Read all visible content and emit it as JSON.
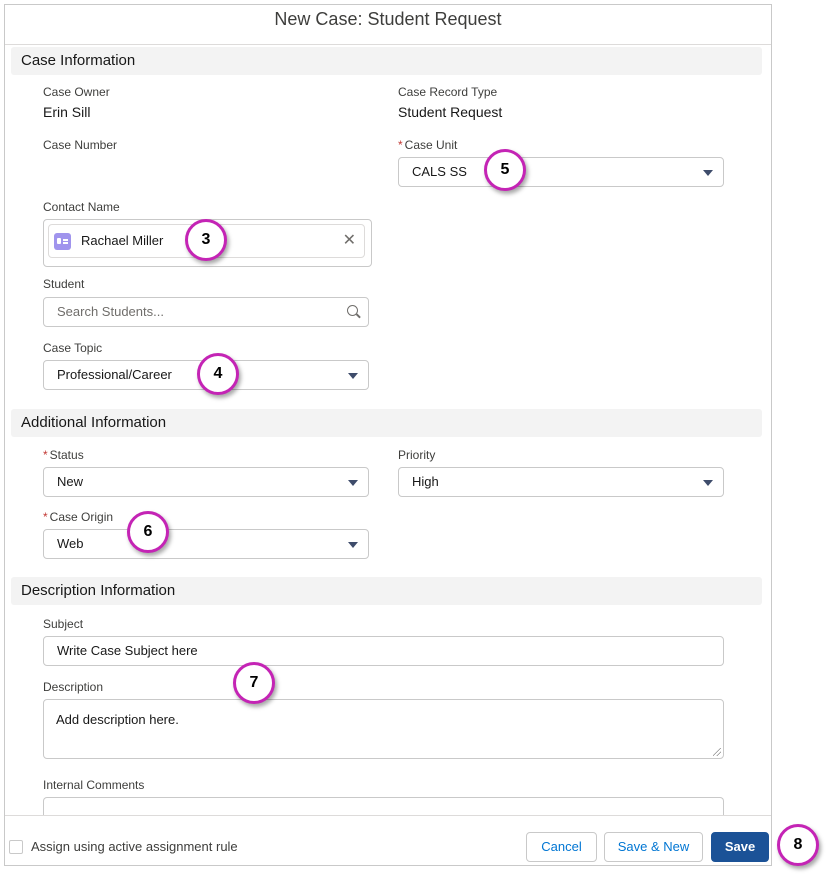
{
  "modal": {
    "title": "New Case: Student Request"
  },
  "sections": {
    "case_information": "Case Information",
    "additional_information": "Additional Information",
    "description_information": "Description Information"
  },
  "fields": {
    "case_owner": {
      "label": "Case Owner",
      "value": "Erin Sill"
    },
    "case_record_type": {
      "label": "Case Record Type",
      "value": "Student Request"
    },
    "case_number": {
      "label": "Case Number",
      "value": ""
    },
    "case_unit": {
      "label": "Case Unit",
      "value": "CALS SS",
      "required": true
    },
    "contact_name": {
      "label": "Contact Name",
      "value": "Rachael Miller"
    },
    "student": {
      "label": "Student",
      "placeholder": "Search Students..."
    },
    "case_topic": {
      "label": "Case Topic",
      "value": "Professional/Career"
    },
    "status": {
      "label": "Status",
      "value": "New",
      "required": true
    },
    "priority": {
      "label": "Priority",
      "value": "High"
    },
    "case_origin": {
      "label": "Case Origin",
      "value": "Web",
      "required": true
    },
    "subject": {
      "label": "Subject",
      "value": "Write Case Subject here"
    },
    "description": {
      "label": "Description",
      "value": "Add description here."
    },
    "internal_comments": {
      "label": "Internal Comments",
      "value": ""
    }
  },
  "required_marker": "*",
  "footer": {
    "assign_rule_label": "Assign using active assignment rule",
    "cancel": "Cancel",
    "save_new": "Save & New",
    "save": "Save"
  },
  "callouts": [
    "3",
    "4",
    "5",
    "6",
    "7",
    "8"
  ],
  "icons": {
    "contact": "contact-card-icon",
    "clear": "close-icon",
    "search": "search-icon",
    "dropdown": "chevron-down-icon"
  },
  "colors": {
    "accent": "#1b5297",
    "callout_ring": "#c424b5",
    "required": "#c23934",
    "section_bg": "#f3f3f3"
  }
}
